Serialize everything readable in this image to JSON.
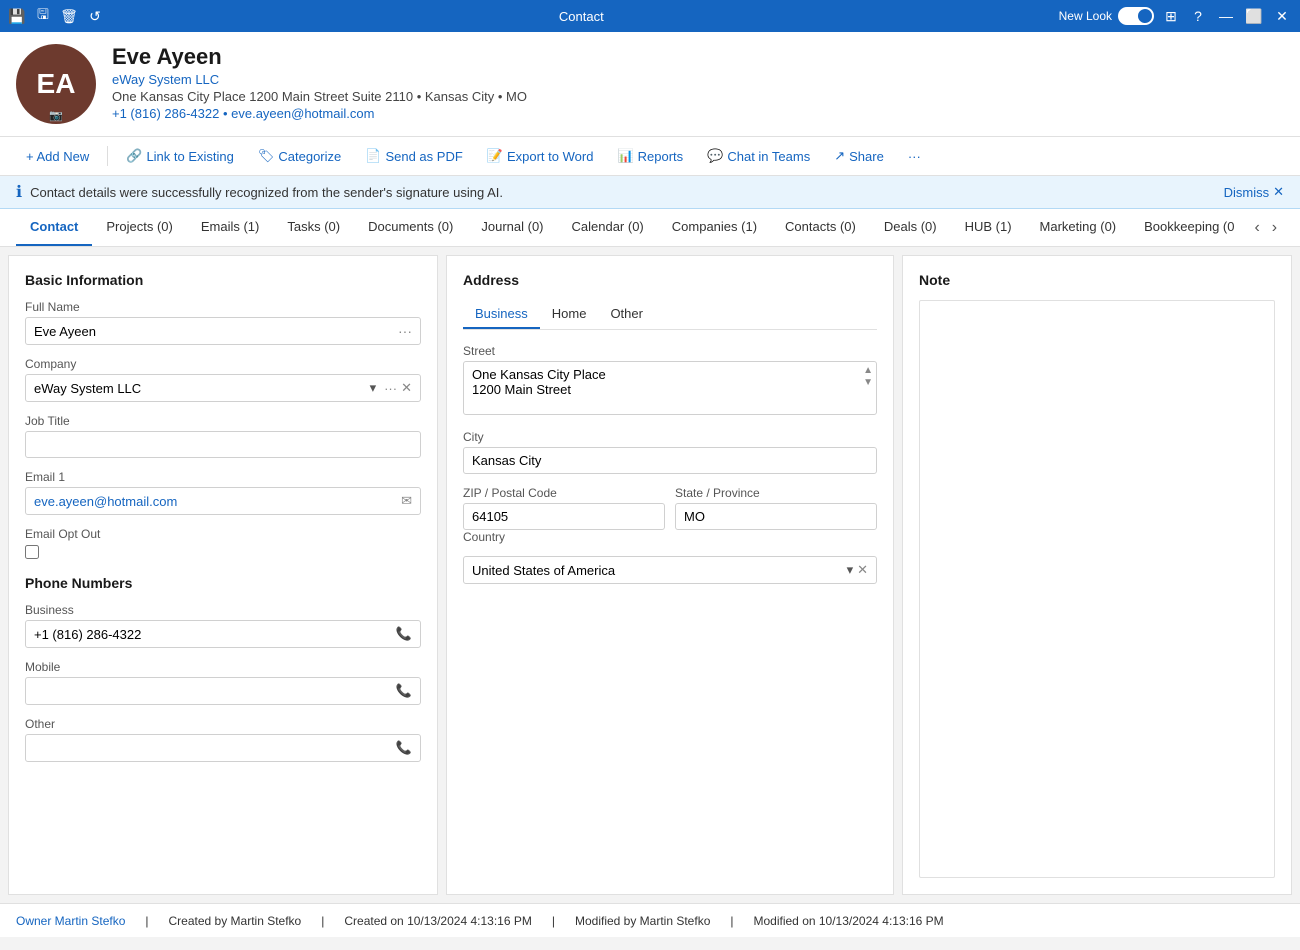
{
  "titlebar": {
    "title": "Contact",
    "new_look_label": "New Look",
    "help_icon": "?",
    "minimize_icon": "—",
    "maximize_icon": "⬜",
    "close_icon": "✕"
  },
  "contact": {
    "initials": "EA",
    "name": "Eve Ayeen",
    "company": "eWay System LLC",
    "address_line1": "One Kansas City Place 1200 Main Street Suite 2110",
    "address_line2": "Kansas City • MO",
    "phone": "+1 (816) 286-4322",
    "email": "eve.ayeen@hotmail.com"
  },
  "toolbar": {
    "add_new_label": "+ Add New",
    "link_existing_label": "Link to Existing",
    "categorize_label": "Categorize",
    "send_pdf_label": "Send as PDF",
    "export_word_label": "Export to Word",
    "reports_label": "Reports",
    "chat_teams_label": "Chat in Teams",
    "share_label": "Share",
    "more_label": "···"
  },
  "banner": {
    "message": "Contact details were successfully recognized from the sender's signature using AI.",
    "dismiss_label": "Dismiss"
  },
  "tabs": [
    {
      "label": "Contact",
      "active": true
    },
    {
      "label": "Projects (0)",
      "active": false
    },
    {
      "label": "Emails (1)",
      "active": false
    },
    {
      "label": "Tasks (0)",
      "active": false
    },
    {
      "label": "Documents (0)",
      "active": false
    },
    {
      "label": "Journal (0)",
      "active": false
    },
    {
      "label": "Calendar (0)",
      "active": false
    },
    {
      "label": "Companies (1)",
      "active": false
    },
    {
      "label": "Contacts (0)",
      "active": false
    },
    {
      "label": "Deals (0)",
      "active": false
    },
    {
      "label": "HUB (1)",
      "active": false
    },
    {
      "label": "Marketing (0)",
      "active": false
    },
    {
      "label": "Bookkeeping (0",
      "active": false
    }
  ],
  "basic_info": {
    "section_title": "Basic Information",
    "full_name_label": "Full Name",
    "full_name_value": "Eve Ayeen",
    "company_label": "Company",
    "company_value": "eWay System LLC",
    "job_title_label": "Job Title",
    "job_title_value": "",
    "email1_label": "Email 1",
    "email1_value": "eve.ayeen@hotmail.com",
    "email_opt_out_label": "Email Opt Out",
    "phone_section_title": "Phone Numbers",
    "business_label": "Business",
    "business_value": "+1 (816) 286-4322",
    "mobile_label": "Mobile",
    "mobile_value": "",
    "other_label": "Other",
    "other_value": ""
  },
  "address": {
    "section_title": "Address",
    "tabs": [
      {
        "label": "Business",
        "active": true
      },
      {
        "label": "Home",
        "active": false
      },
      {
        "label": "Other",
        "active": false
      }
    ],
    "street_label": "Street",
    "street_line1": "One Kansas City Place",
    "street_line2": "1200 Main Street",
    "city_label": "City",
    "city_value": "Kansas City",
    "zip_label": "ZIP / Postal Code",
    "zip_value": "64105",
    "state_label": "State / Province",
    "state_value": "MO",
    "country_label": "Country",
    "country_value": "United States of America"
  },
  "note": {
    "section_title": "Note"
  },
  "statusbar": {
    "owner_label": "Owner",
    "owner_value": "Martin Stefko",
    "created_by_label": "Created by",
    "created_by_value": "Martin Stefko",
    "created_on_label": "Created on",
    "created_on_value": "10/13/2024 4:13:16 PM",
    "modified_by_label": "Modified by",
    "modified_by_value": "Martin Stefko",
    "modified_on_label": "Modified on",
    "modified_on_value": "10/13/2024 4:13:16 PM"
  }
}
